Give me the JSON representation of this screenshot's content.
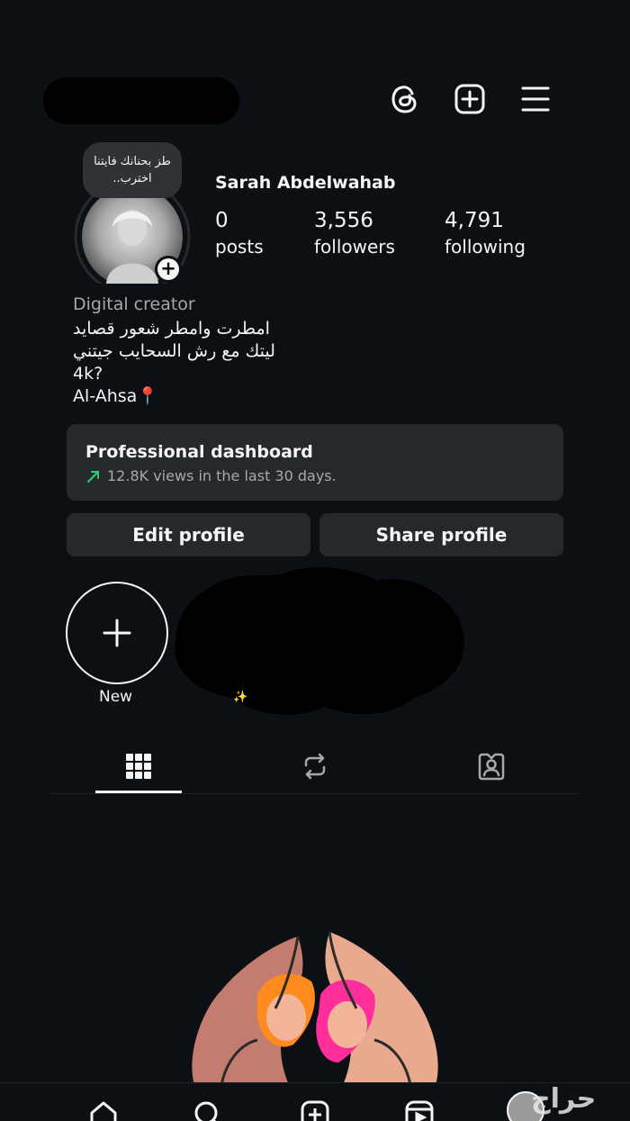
{
  "header": {
    "username_redacted": "",
    "icons": [
      "threads-icon",
      "create-icon",
      "menu-icon"
    ]
  },
  "profile": {
    "note": "طز بحنانك فايتنا اخترب..",
    "name": "Sarah Abdelwahab",
    "stats": [
      {
        "value": "0",
        "label": "posts"
      },
      {
        "value": "3,556",
        "label": "followers"
      },
      {
        "value": "4,791",
        "label": "following"
      }
    ],
    "category": "Digital creator",
    "bio": [
      "امطرت وامطر شعور قصايد",
      "ليتك مع رش السحايب جيتني",
      "4k?",
      "Al-Ahsa📍"
    ]
  },
  "dashboard": {
    "title": "Professional dashboard",
    "stat": "12.8K views in the last 30 days.",
    "accent": "#2ecc71"
  },
  "actions": {
    "edit": "Edit profile",
    "share": "Share profile"
  },
  "highlights": {
    "new_label": "New",
    "sparkle": "✨"
  },
  "tabs": [
    "grid-icon",
    "reposts-icon",
    "tagged-icon"
  ],
  "watermark": "حراج"
}
